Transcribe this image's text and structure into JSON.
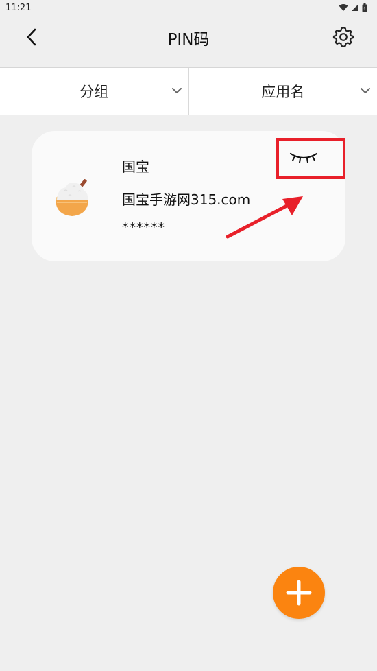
{
  "status_bar": {
    "time": "11:21"
  },
  "header": {
    "title": "PIN码"
  },
  "filters": [
    {
      "label": "分组"
    },
    {
      "label": "应用名"
    }
  ],
  "entry": {
    "name": "国宝",
    "account": "国宝手游网315.com",
    "pin_masked": "******"
  },
  "colors": {
    "accent": "#FB8410",
    "highlight": "#E8202A",
    "background": "#EFEFEF"
  },
  "icons": {
    "back": "back-arrow-icon",
    "settings": "gear-icon",
    "dropdown": "chevron-down-icon",
    "visibility": "eye-closed-icon",
    "add": "plus-icon"
  }
}
